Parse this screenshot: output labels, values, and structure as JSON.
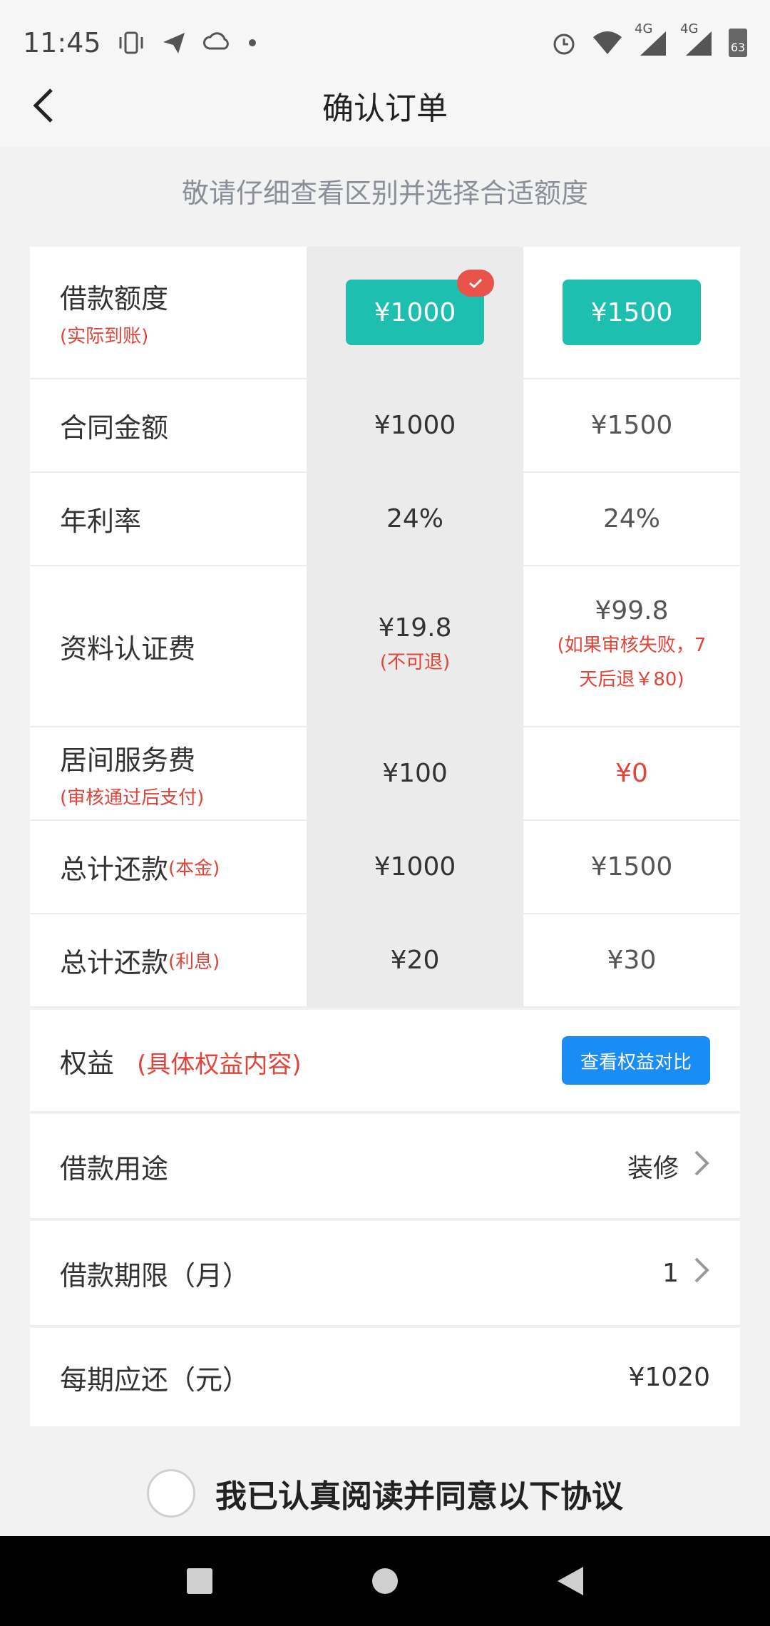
{
  "status_bar": {
    "time": "11:45",
    "icons_left": [
      "vibrate-icon",
      "send-icon",
      "cloud-icon",
      "dot-icon"
    ],
    "icons_right": [
      "alarm-icon",
      "wifi-icon",
      "signal-4g-icon",
      "signal-4g-icon",
      "battery-icon"
    ],
    "net1": "4G",
    "net2": "4G",
    "battery": "63"
  },
  "header": {
    "title": "确认订单",
    "back_icon": "back-arrow-icon"
  },
  "hint": "敬请仔细查看区别并选择合适额度",
  "table": {
    "rows": [
      {
        "label": "借款额度",
        "sub": "(实际到账)",
        "a": "¥1000",
        "b": "¥1500"
      },
      {
        "label": "合同金额",
        "a": "¥1000",
        "b": "¥1500"
      },
      {
        "label": "年利率",
        "a": "24%",
        "b": "24%"
      },
      {
        "label": "资料认证费",
        "a": "¥19.8",
        "a_note": "(不可退)",
        "b": "¥99.8",
        "b_note": "(如果审核失败，7天后退￥80)"
      },
      {
        "label": "居间服务费",
        "sub": "(审核通过后支付)",
        "a": "¥100",
        "b": "¥0"
      },
      {
        "label": "总计还款",
        "inline_sub": "(本金)",
        "a": "¥1000",
        "b": "¥1500"
      },
      {
        "label": "总计还款",
        "inline_sub": "(利息)",
        "a": "¥20",
        "b": "¥30"
      }
    ],
    "selected_option": "¥1000",
    "accent_color": "#1fbfb0",
    "red_color": "#e0443a"
  },
  "rights": {
    "label": "权益",
    "sub": "(具体权益内容)",
    "button": "查看权益对比"
  },
  "purpose": {
    "label": "借款用途",
    "value": "装修"
  },
  "term": {
    "label": "借款期限（月）",
    "value": "1"
  },
  "installment": {
    "label": "每期应还（元）",
    "value": "¥1020"
  },
  "agreement": {
    "text": "我已认真阅读并同意以下协议"
  },
  "system_nav": [
    "recent-apps-icon",
    "home-icon",
    "back-icon"
  ]
}
